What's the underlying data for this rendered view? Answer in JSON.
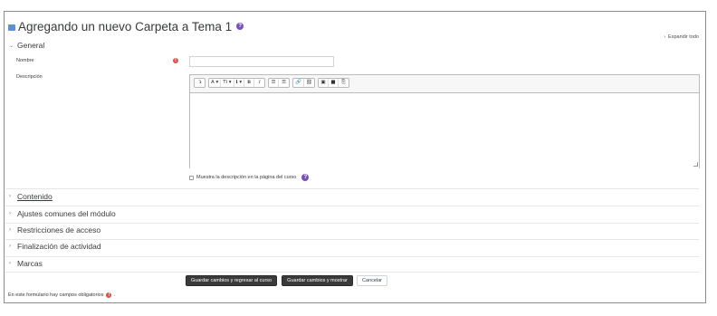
{
  "header": {
    "title": "Agregando un nuevo Carpeta a Tema 1",
    "help_glyph": "?",
    "expand_all": "Expandir todo",
    "expand_arrow": "›"
  },
  "sections": {
    "general": {
      "label": "General",
      "chevron": "⌄"
    },
    "contenido": {
      "label": "Contenido",
      "chevron": "›"
    },
    "ajustes": {
      "label": "Ajustes comunes del módulo",
      "chevron": "›"
    },
    "restricciones": {
      "label": "Restricciones de acceso",
      "chevron": "›"
    },
    "finalizacion": {
      "label": "Finalización de actividad",
      "chevron": "›"
    },
    "marcas": {
      "label": "Marcas",
      "chevron": "›"
    }
  },
  "form": {
    "name_label": "Nombre",
    "name_value": "",
    "required_glyph": "!",
    "description_label": "Descripción",
    "description_value": "",
    "show_description_label": "Muestra la descripción en la página del curso",
    "show_description_checked": false
  },
  "editor_toolbar": {
    "groups": [
      [
        "↴"
      ],
      [
        "A ▾",
        "Ti ▾",
        "ℹ ▾",
        "B",
        "I"
      ],
      [
        "☰",
        "☰"
      ],
      [
        "🔗",
        "⛓"
      ],
      [
        "▣",
        "■",
        "⎘"
      ]
    ]
  },
  "buttons": {
    "save_return": "Guardar cambios y regresar al curso",
    "save_show": "Guardar cambios y mostrar",
    "cancel": "Cancelar"
  },
  "footer": {
    "required_note": "En este formulario hay campos obligatorios",
    "required_note_suffix": "."
  },
  "colors": {
    "primary_button": "#3a3a3a",
    "required": "#d9534f",
    "help": "#7b4fb8",
    "folder_icon": "#5b8fd8"
  }
}
